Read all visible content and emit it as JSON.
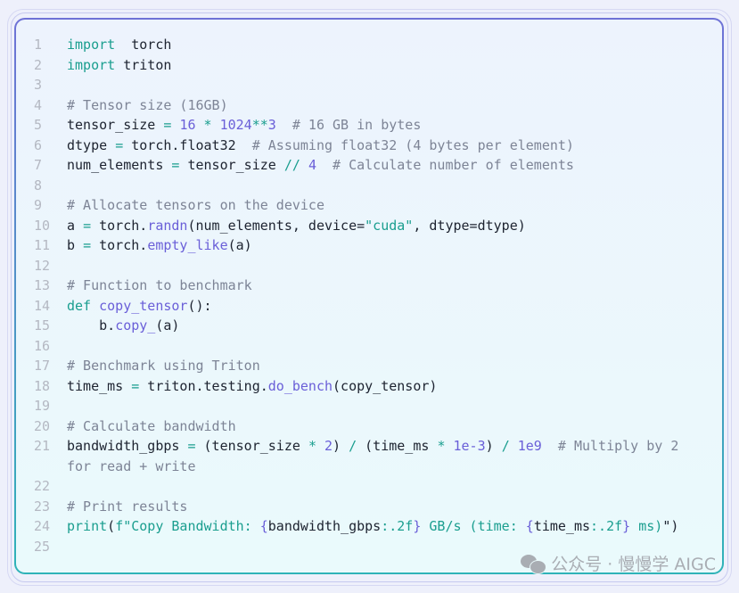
{
  "code": {
    "lines": [
      {
        "n": "1",
        "t": [
          [
            "kw",
            "import"
          ],
          [
            "",
            "  torch"
          ]
        ]
      },
      {
        "n": "2",
        "t": [
          [
            "kw",
            "import"
          ],
          [
            "",
            " triton"
          ]
        ]
      },
      {
        "n": "3",
        "t": []
      },
      {
        "n": "4",
        "t": [
          [
            "cm",
            "# Tensor size (16GB)"
          ]
        ]
      },
      {
        "n": "5",
        "t": [
          [
            "",
            "tensor_size "
          ],
          [
            "op",
            "="
          ],
          [
            "",
            " "
          ],
          [
            "num",
            "16"
          ],
          [
            "",
            " "
          ],
          [
            "op",
            "*"
          ],
          [
            "",
            " "
          ],
          [
            "num",
            "1024"
          ],
          [
            "op",
            "**"
          ],
          [
            "num",
            "3"
          ],
          [
            "cm",
            "  # 16 GB in bytes"
          ]
        ]
      },
      {
        "n": "6",
        "t": [
          [
            "",
            "dtype "
          ],
          [
            "op",
            "="
          ],
          [
            "",
            " torch.float32"
          ],
          [
            "cm",
            "  # Assuming float32 (4 bytes per element)"
          ]
        ]
      },
      {
        "n": "7",
        "t": [
          [
            "",
            "num_elements "
          ],
          [
            "op",
            "="
          ],
          [
            "",
            " tensor_size "
          ],
          [
            "op",
            "//"
          ],
          [
            "",
            " "
          ],
          [
            "num",
            "4"
          ],
          [
            "cm",
            "  # Calculate number of elements"
          ]
        ]
      },
      {
        "n": "8",
        "t": []
      },
      {
        "n": "9",
        "t": [
          [
            "cm",
            "# Allocate tensors on the device"
          ]
        ]
      },
      {
        "n": "10",
        "t": [
          [
            "",
            "a "
          ],
          [
            "op",
            "="
          ],
          [
            "",
            " torch."
          ],
          [
            "fn",
            "randn"
          ],
          [
            "",
            "(num_elements, device="
          ],
          [
            "str",
            "\"cuda\""
          ],
          [
            "",
            ", dtype=dtype)"
          ]
        ]
      },
      {
        "n": "11",
        "t": [
          [
            "",
            "b "
          ],
          [
            "op",
            "="
          ],
          [
            "",
            " torch."
          ],
          [
            "fn",
            "empty_like"
          ],
          [
            "",
            "(a)"
          ]
        ]
      },
      {
        "n": "12",
        "t": []
      },
      {
        "n": "13",
        "t": [
          [
            "cm",
            "# Function to benchmark"
          ]
        ]
      },
      {
        "n": "14",
        "t": [
          [
            "kw",
            "def"
          ],
          [
            "",
            " "
          ],
          [
            "fn",
            "copy_tensor"
          ],
          [
            "",
            "():"
          ]
        ]
      },
      {
        "n": "15",
        "t": [
          [
            "",
            "    b."
          ],
          [
            "fn",
            "copy_"
          ],
          [
            "",
            "(a)"
          ]
        ]
      },
      {
        "n": "16",
        "t": []
      },
      {
        "n": "17",
        "t": [
          [
            "cm",
            "# Benchmark using Triton"
          ]
        ]
      },
      {
        "n": "18",
        "t": [
          [
            "",
            "time_ms "
          ],
          [
            "op",
            "="
          ],
          [
            "",
            " triton.testing."
          ],
          [
            "fn",
            "do_bench"
          ],
          [
            "",
            "(copy_tensor)"
          ]
        ]
      },
      {
        "n": "19",
        "t": []
      },
      {
        "n": "20",
        "t": [
          [
            "cm",
            "# Calculate bandwidth"
          ]
        ]
      },
      {
        "n": "21",
        "t": [
          [
            "",
            "bandwidth_gbps "
          ],
          [
            "op",
            "="
          ],
          [
            "",
            " (tensor_size "
          ],
          [
            "op",
            "*"
          ],
          [
            "",
            " "
          ],
          [
            "num",
            "2"
          ],
          [
            "",
            ") "
          ],
          [
            "op",
            "/"
          ],
          [
            "",
            " (time_ms "
          ],
          [
            "op",
            "*"
          ],
          [
            "",
            " "
          ],
          [
            "num",
            "1e-3"
          ],
          [
            "",
            ") "
          ],
          [
            "op",
            "/"
          ],
          [
            "",
            " "
          ],
          [
            "num",
            "1e9"
          ],
          [
            "cm",
            "  # Multiply by 2 for read + write"
          ]
        ]
      },
      {
        "n": "22",
        "t": []
      },
      {
        "n": "23",
        "t": [
          [
            "cm",
            "# Print results"
          ]
        ]
      },
      {
        "n": "24",
        "t": [
          [
            "kw",
            "print"
          ],
          [
            "",
            "("
          ],
          [
            "str",
            "f\"Copy Bandwidth: "
          ],
          [
            "br",
            "{"
          ],
          [
            "",
            "bandwidth_gbps"
          ],
          [
            "str",
            ":.2f"
          ],
          [
            "br",
            "}"
          ],
          [
            "str",
            " GB/s (time: "
          ],
          [
            "br",
            "{"
          ],
          [
            "",
            "time_ms"
          ],
          [
            "str",
            ":.2f"
          ],
          [
            "br",
            "}"
          ],
          [
            "str",
            " ms)"
          ],
          [
            "",
            "\")"
          ]
        ]
      },
      {
        "n": "25",
        "t": []
      }
    ]
  },
  "watermark": {
    "text": "公众号 · 慢慢学 AIGC",
    "icon": "wechat-icon"
  },
  "colors": {
    "keyword": "#1a9e8f",
    "number": "#6a5fd8",
    "comment": "#7d8496",
    "text": "#1d2330"
  }
}
